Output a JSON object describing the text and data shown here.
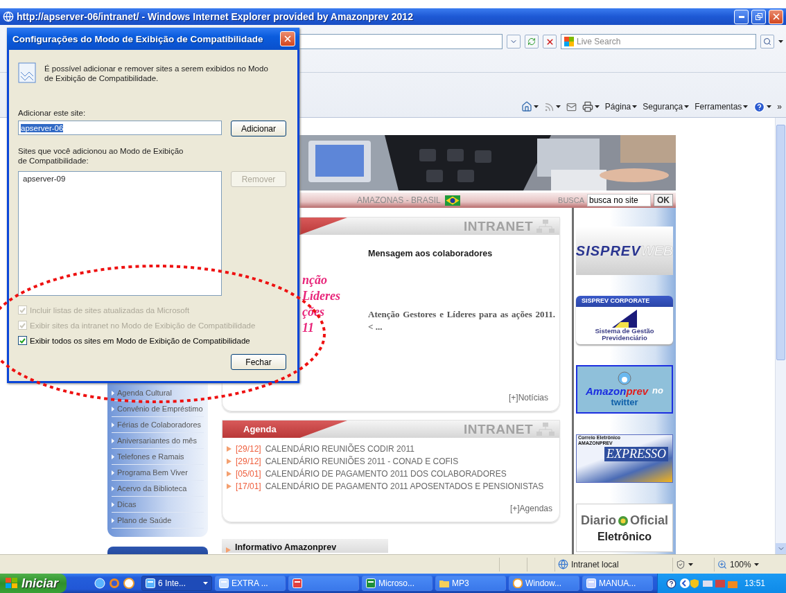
{
  "window": {
    "title": "http://apserver-06/intranet/ - Windows Internet Explorer provided by Amazonprev 2012"
  },
  "address_bar": {
    "search_placeholder": "Live Search"
  },
  "command_bar": {
    "menus": [
      "Página",
      "Segurança",
      "Ferramentas"
    ],
    "more": "»"
  },
  "page": {
    "location": "AMAZONAS - BRASIL",
    "search_label": "BUSCA",
    "search_value": "busca no site",
    "search_button": "OK",
    "menu": [
      "Agenda Cultural",
      "Convênio de Empréstimo",
      "Férias de Colaboradores",
      "Aniversariantes do mês",
      "Telefones e Ramais",
      "Programa Bem Viver",
      "Acervo da Biblioteca",
      "Dicas",
      "Plano de Saúde"
    ],
    "news": {
      "brand": "INTRANET",
      "promo_lines": [
        "nção",
        "Líderes",
        "ções",
        "11"
      ],
      "title": "Mensagem aos colaboradores",
      "summary": "Atenção Gestores e Líderes para as ações 2011. < ...",
      "more": "[+]Notícias"
    },
    "agenda": {
      "title": "Agenda",
      "brand": "INTRANET",
      "items": [
        {
          "date": "[29/12]",
          "text": "CALENDÁRIO REUNIÕES CODIR 2011"
        },
        {
          "date": "[29/12]",
          "text": "CALENDÁRIO REUNIÕES 2011 - CONAD E COFIS"
        },
        {
          "date": "[05/01]",
          "text": "CALENDÁRIO DE PAGAMENTO 2011 DOS COLABORADORES"
        },
        {
          "date": "[17/01]",
          "text": "CALENDÁRIO DE PAGAMENTO 2011 APOSENTADOS E PENSIONISTAS"
        }
      ],
      "more": "[+]Agendas"
    },
    "informativo": {
      "title": "Informativo Amazonprev"
    },
    "banners": [
      {
        "kind": "sisprev_web",
        "texts": [
          "SISPREV",
          "WEB"
        ]
      },
      {
        "kind": "sisprev_corporate",
        "texts": [
          "SISPREV CORPORATE",
          "Sistema de Gestão",
          "Previdenciário"
        ]
      },
      {
        "kind": "twitter",
        "texts": [
          "Amazon",
          "prev",
          "no",
          "twitter"
        ]
      },
      {
        "kind": "expresso",
        "texts": [
          "Correio Eletrônico",
          "AMAZONPREV",
          "EXPRESSO"
        ]
      },
      {
        "kind": "diario",
        "texts": [
          "Diario",
          "Oficial",
          "Eletrônico"
        ]
      }
    ]
  },
  "dialog": {
    "title": "Configurações do Modo de Exibição de Compatibilidade",
    "intro": "É possível adicionar e remover sites a serem exibidos no Modo de Exibição de Compatibilidade.",
    "add_label": "Adicionar este site:",
    "add_value": "apserver-06",
    "add_button": "Adicionar",
    "list_label_lines": [
      "Sites que você adicionou ao Modo de Exibição",
      "de Compatibilidade:"
    ],
    "sites": [
      "apserver-09"
    ],
    "remove_button": {
      "label": "Remover",
      "disabled": true
    },
    "options": [
      {
        "label": "Incluir listas de sites atualizadas da Microsoft",
        "checked": true,
        "disabled": true
      },
      {
        "label": "Exibir sites da intranet no Modo de Exibição de Compatibilidade",
        "checked": true,
        "disabled": true
      },
      {
        "label": "Exibir todos os sites em Modo de Exibição de Compatibilidade",
        "checked": true,
        "disabled": false
      }
    ],
    "close_button": "Fechar"
  },
  "status_bar": {
    "zone": "Intranet local",
    "zoom": "100%"
  },
  "taskbar": {
    "start": "Iniciar",
    "tasks": [
      {
        "kind": "ie",
        "label": "6 Inte...",
        "selected": true
      },
      {
        "kind": "app",
        "label": "EXTRA ...",
        "selected": false
      },
      {
        "kind": "chart",
        "selected": false
      },
      {
        "kind": "excel",
        "label": "Microso...",
        "selected": false
      },
      {
        "kind": "folder",
        "label": "MP3",
        "selected": false
      },
      {
        "kind": "media",
        "label": "Window...",
        "selected": false
      },
      {
        "kind": "word",
        "label": "MANUA...",
        "selected": false
      }
    ],
    "clock": "13:51"
  }
}
